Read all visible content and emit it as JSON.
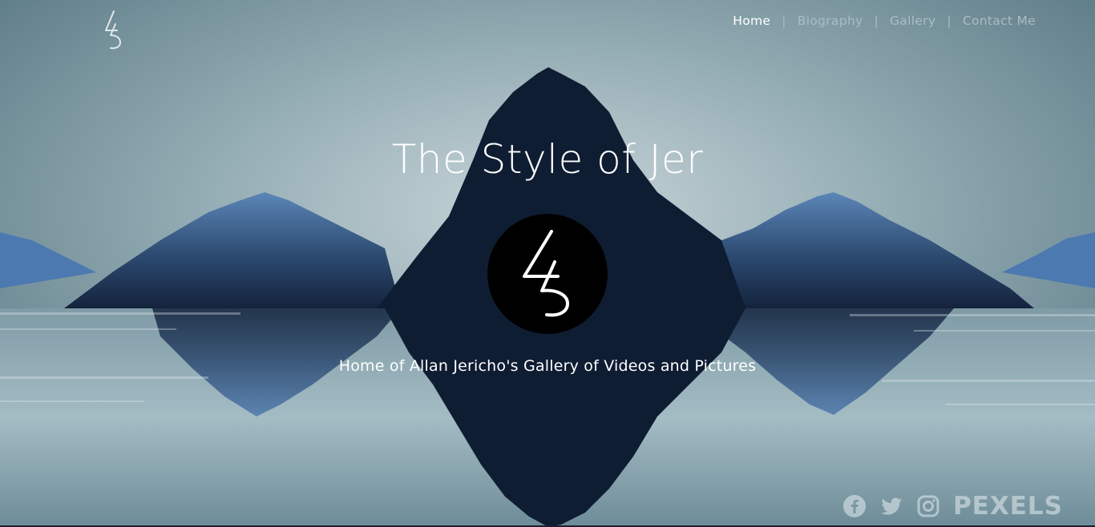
{
  "brand": {
    "logo_icon": "jer-45-logo-icon"
  },
  "nav": {
    "items": [
      {
        "label": "Home",
        "active": true
      },
      {
        "label": "Biography",
        "active": false
      },
      {
        "label": "Gallery",
        "active": false
      },
      {
        "label": "Contact Me",
        "active": false
      }
    ],
    "separator": "|"
  },
  "hero": {
    "title": "The Style of Jer",
    "logo_icon": "jer-45-circle-logo-icon",
    "subtitle": "Home of Allan Jericho's Gallery of Videos and Pictures"
  },
  "footer": {
    "social_icons": [
      "facebook-icon",
      "twitter-icon",
      "instagram-icon"
    ],
    "watermark": "PEXELS"
  },
  "colors": {
    "sky": "#8fa9b3",
    "mountain_dark": "#0f1d33",
    "mountain_blue": "#3d6691",
    "text": "#ffffff",
    "nav_inactive": "#a9bcc4"
  }
}
